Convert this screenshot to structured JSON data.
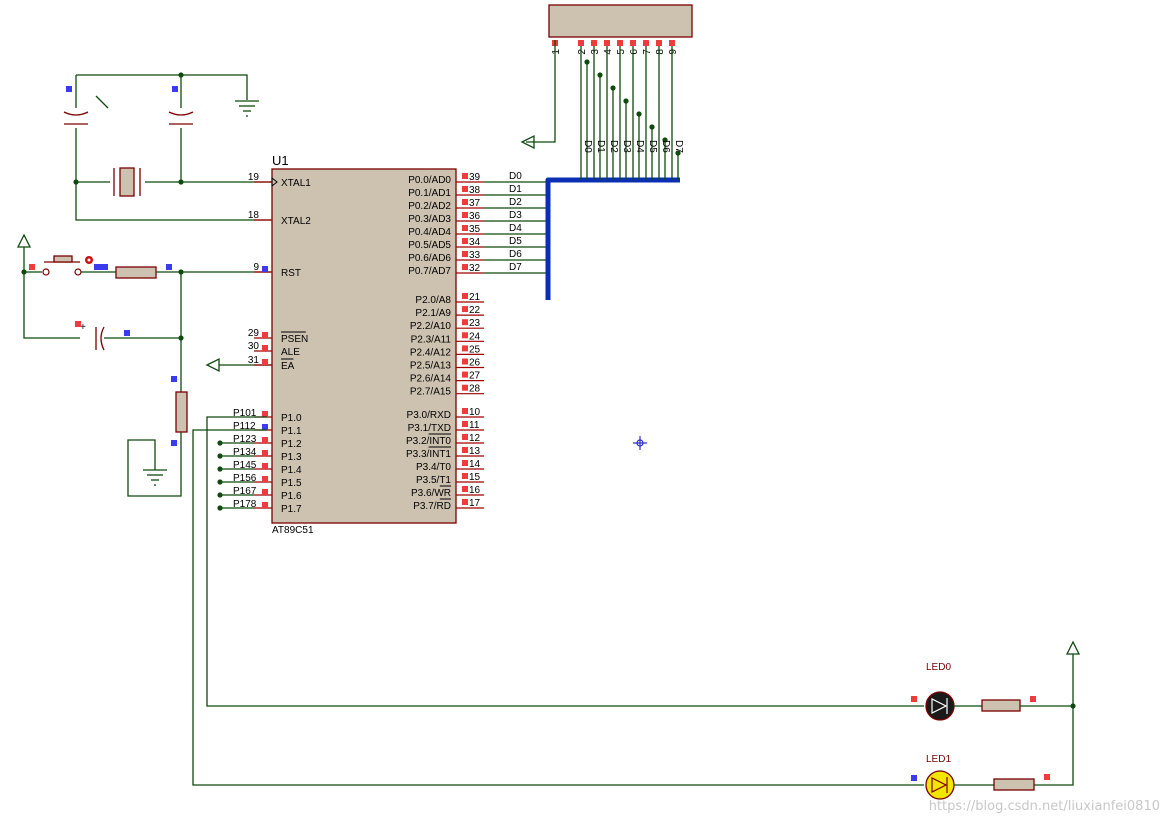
{
  "title": "",
  "chip": {
    "ref": "U1",
    "part": "AT89C51",
    "left_pins": [
      {
        "num": "19",
        "name": "XTAL1"
      },
      {
        "num": "18",
        "name": "XTAL2"
      },
      {
        "num": "9",
        "name": "RST"
      },
      {
        "num": "29",
        "name": "PSEN"
      },
      {
        "num": "30",
        "name": "ALE"
      },
      {
        "num": "31",
        "name": "EA"
      },
      {
        "num": "1",
        "name": "P1.0"
      },
      {
        "num": "2",
        "name": "P1.1"
      },
      {
        "num": "3",
        "name": "P1.2"
      },
      {
        "num": "4",
        "name": "P1.3"
      },
      {
        "num": "5",
        "name": "P1.4"
      },
      {
        "num": "6",
        "name": "P1.5"
      },
      {
        "num": "7",
        "name": "P1.6"
      },
      {
        "num": "8",
        "name": "P1.7"
      }
    ],
    "p1_net_labels": [
      "P101",
      "P112",
      "P123",
      "P134",
      "P145",
      "P156",
      "P167",
      "P178"
    ],
    "right_pins": [
      {
        "num": "39",
        "name": "P0.0/AD0"
      },
      {
        "num": "38",
        "name": "P0.1/AD1"
      },
      {
        "num": "37",
        "name": "P0.2/AD2"
      },
      {
        "num": "36",
        "name": "P0.3/AD3"
      },
      {
        "num": "35",
        "name": "P0.4/AD4"
      },
      {
        "num": "34",
        "name": "P0.5/AD5"
      },
      {
        "num": "33",
        "name": "P0.6/AD6"
      },
      {
        "num": "32",
        "name": "P0.7/AD7"
      },
      {
        "num": "21",
        "name": "P2.0/A8"
      },
      {
        "num": "22",
        "name": "P2.1/A9"
      },
      {
        "num": "23",
        "name": "P2.2/A10"
      },
      {
        "num": "24",
        "name": "P2.3/A11"
      },
      {
        "num": "25",
        "name": "P2.4/A12"
      },
      {
        "num": "26",
        "name": "P2.5/A13"
      },
      {
        "num": "27",
        "name": "P2.6/A14"
      },
      {
        "num": "28",
        "name": "P2.7/A15"
      },
      {
        "num": "10",
        "name": "P3.0/RXD"
      },
      {
        "num": "11",
        "name": "P3.1/TXD"
      },
      {
        "num": "12",
        "name": "P3.2/INT0"
      },
      {
        "num": "13",
        "name": "P3.3/INT1"
      },
      {
        "num": "14",
        "name": "P3.4/T0"
      },
      {
        "num": "15",
        "name": "P3.5/T1"
      },
      {
        "num": "16",
        "name": "P3.6/WR"
      },
      {
        "num": "17",
        "name": "P3.7/RD"
      }
    ]
  },
  "bus_labels": [
    "D0",
    "D1",
    "D2",
    "D3",
    "D4",
    "D5",
    "D6",
    "D7"
  ],
  "resistor_pack": {
    "pins": [
      "1",
      "2",
      "3",
      "4",
      "5",
      "6",
      "7",
      "8",
      "9"
    ],
    "net_labels": [
      "D0",
      "D1",
      "D2",
      "D3",
      "D4",
      "D5",
      "D6",
      "D7"
    ]
  },
  "leds": [
    {
      "label": "LED0",
      "color": "#1a1a1a"
    },
    {
      "label": "LED1",
      "color": "#f2e600"
    }
  ],
  "colors": {
    "wire": "#0f4a0f",
    "bus": "#0a2fb4",
    "chip_body": "#cdc2b0",
    "component": "#7a0000",
    "pin_marker_red": "#ee3b3b",
    "pin_marker_blue": "#3a3aee"
  },
  "watermark": "https://blog.csdn.net/liuxianfei0810"
}
